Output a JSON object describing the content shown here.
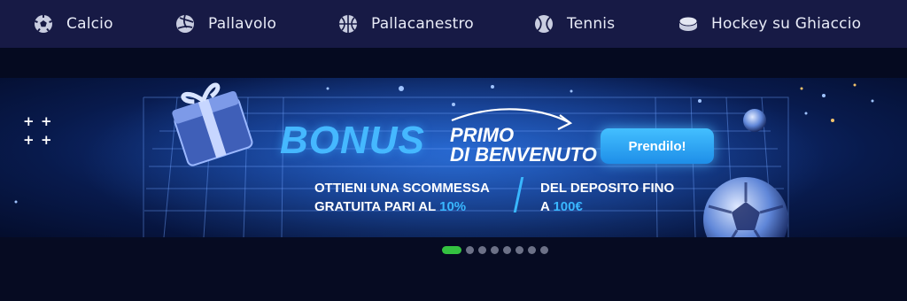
{
  "nav": {
    "items": [
      {
        "label": "Calcio",
        "icon": "soccer-ball-icon"
      },
      {
        "label": "Pallavolo",
        "icon": "volleyball-icon"
      },
      {
        "label": "Pallacanestro",
        "icon": "basketball-icon"
      },
      {
        "label": "Tennis",
        "icon": "tennis-ball-icon"
      },
      {
        "label": "Hockey su Ghiaccio",
        "icon": "hockey-puck-icon"
      }
    ]
  },
  "banner": {
    "headline": "BONUS",
    "subheadline_line1": "PRIMO",
    "subheadline_line2": "DI BENVENUTO",
    "cta_label": "Prendilo!",
    "left_text": {
      "line1": "OTTIENI UNA SCOMMESSA",
      "line2_prefix": "GRATUITA PARI AL ",
      "line2_highlight": "10%"
    },
    "right_text": {
      "line1": "DEL DEPOSITO FINO",
      "line2_prefix": "A ",
      "line2_highlight": "100€"
    },
    "decor_plus": "+"
  },
  "carousel": {
    "slide_count": 8,
    "active_index": 0
  },
  "colors": {
    "nav_bg": "#171a45",
    "page_bg": "#060b22",
    "accent_blue": "#39b7ff",
    "active_dot": "#34c241"
  }
}
